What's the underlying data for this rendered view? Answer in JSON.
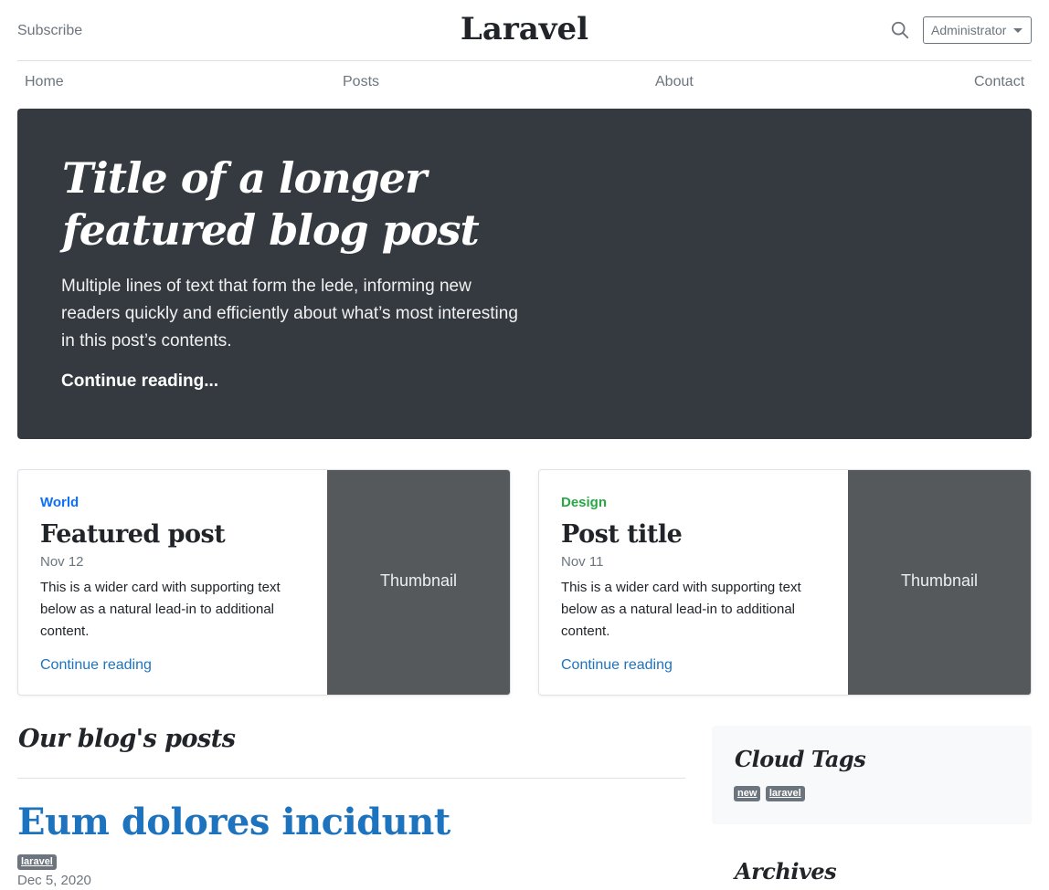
{
  "header": {
    "subscribe_label": "Subscribe",
    "brand": "Laravel",
    "search_icon": "search-icon",
    "user_menu_label": "Administrator"
  },
  "nav": {
    "items": [
      {
        "label": "Home"
      },
      {
        "label": "Posts"
      },
      {
        "label": "About"
      },
      {
        "label": "Contact"
      }
    ]
  },
  "hero": {
    "title": "Title of a longer featured blog post",
    "lede": "Multiple lines of text that form the lede, informing new readers quickly and efficiently about what’s most interesting in this post’s contents.",
    "link_label": "Continue reading..."
  },
  "cards": [
    {
      "category": "World",
      "category_color": "#0d6efd",
      "title": "Featured post",
      "date": "Nov 12",
      "text": "This is a wider card with supporting text below as a natural lead-in to additional content.",
      "link_label": "Continue reading",
      "thumbnail_label": "Thumbnail"
    },
    {
      "category": "Design",
      "category_color": "#28a745",
      "title": "Post title",
      "date": "Nov 11",
      "text": "This is a wider card with supporting text below as a natural lead-in to additional content.",
      "link_label": "Continue reading",
      "thumbnail_label": "Thumbnail"
    }
  ],
  "blog": {
    "heading": "Our blog's posts",
    "posts": [
      {
        "title": "Eum dolores incidunt",
        "tags": [
          "laravel"
        ],
        "date": "Dec 5, 2020"
      }
    ]
  },
  "sidebar": {
    "cloud_tags_title": "Cloud Tags",
    "tags": [
      "new",
      "laravel"
    ],
    "archives_title": "Archives"
  },
  "colors": {
    "link": "#1e73be",
    "hero_bg": "#343a40",
    "thumbnail_bg": "#55595c",
    "badge_bg": "#6c757d"
  }
}
